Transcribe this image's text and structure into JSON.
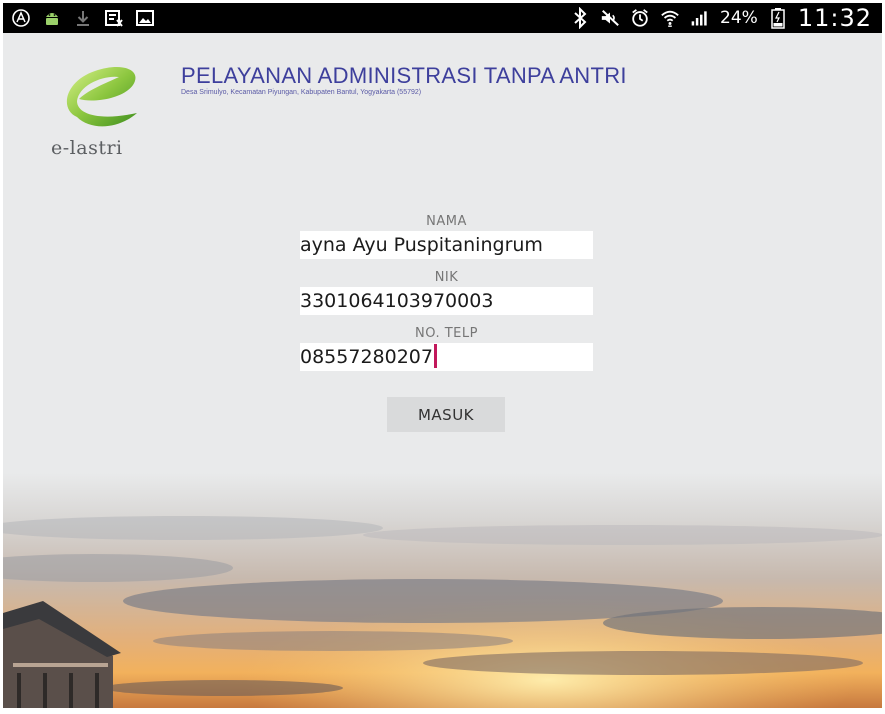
{
  "status_bar": {
    "battery": "24%",
    "time": "11:32",
    "icons_left": [
      "notification-a-icon",
      "android-icon",
      "download-icon",
      "screenshot-icon",
      "image-icon"
    ],
    "icons_right": [
      "bluetooth-icon",
      "mute-icon",
      "alarm-icon",
      "wifi-icon",
      "signal-icon",
      "battery-icon"
    ]
  },
  "header": {
    "logo_text": "e-lastri",
    "title": "PELAYANAN ADMINISTRASI TANPA ANTRI",
    "subtitle": "Desa Srimulyo, Kecamatan Piyungan, Kabupaten Bantul, Yogyakarta (55792)"
  },
  "form": {
    "nama_label": "NAMA",
    "nama_value": "ayna Ayu Puspitaningrum",
    "nik_label": "NIK",
    "nik_value": "3301064103970003",
    "telp_label": "NO. TELP",
    "telp_value": "08557280207",
    "submit_label": "MASUK"
  },
  "colors": {
    "title": "#3d3f9c",
    "caret": "#c2185b",
    "button": "#d9dadb"
  }
}
